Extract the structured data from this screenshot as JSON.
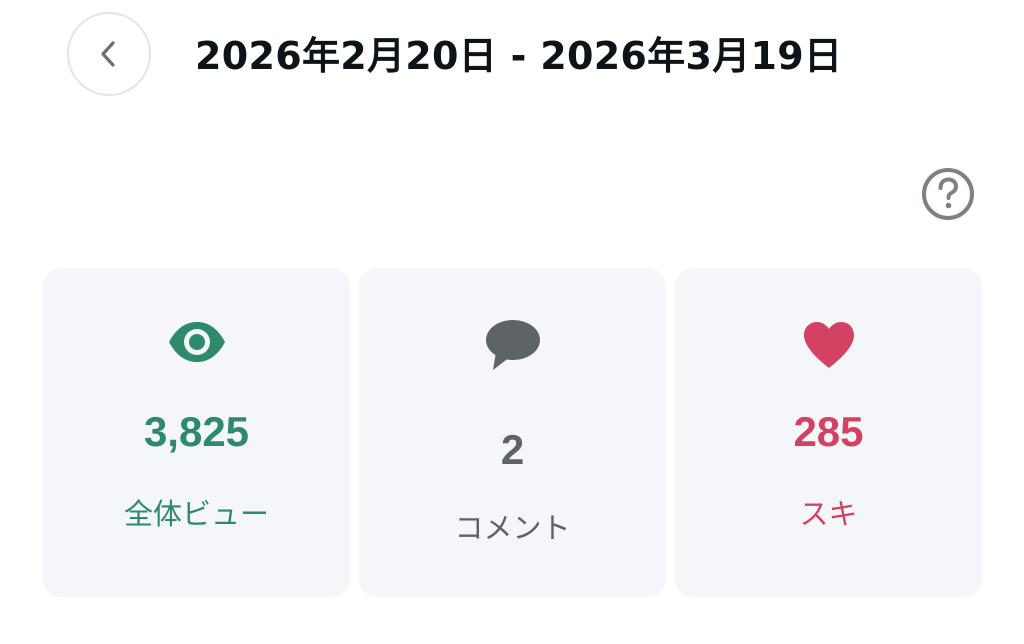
{
  "header": {
    "date_range": "2026年2月20日 - 2026年3月19日",
    "back_icon": "chevron-left-icon",
    "help_icon": "question-circle-icon"
  },
  "stats": {
    "views": {
      "value": "3,825",
      "label": "全体ビュー",
      "icon": "eye-icon",
      "color": "#2f8a6c"
    },
    "comments": {
      "value": "2",
      "label": "コメント",
      "icon": "speech-bubble-icon",
      "color": "#5d6366"
    },
    "likes": {
      "value": "285",
      "label": "スキ",
      "icon": "heart-icon",
      "color": "#d34263"
    }
  },
  "colors": {
    "card_background": "#f4f6f9",
    "title_text": "#0d1419",
    "icon_gray": "#7d8185"
  }
}
